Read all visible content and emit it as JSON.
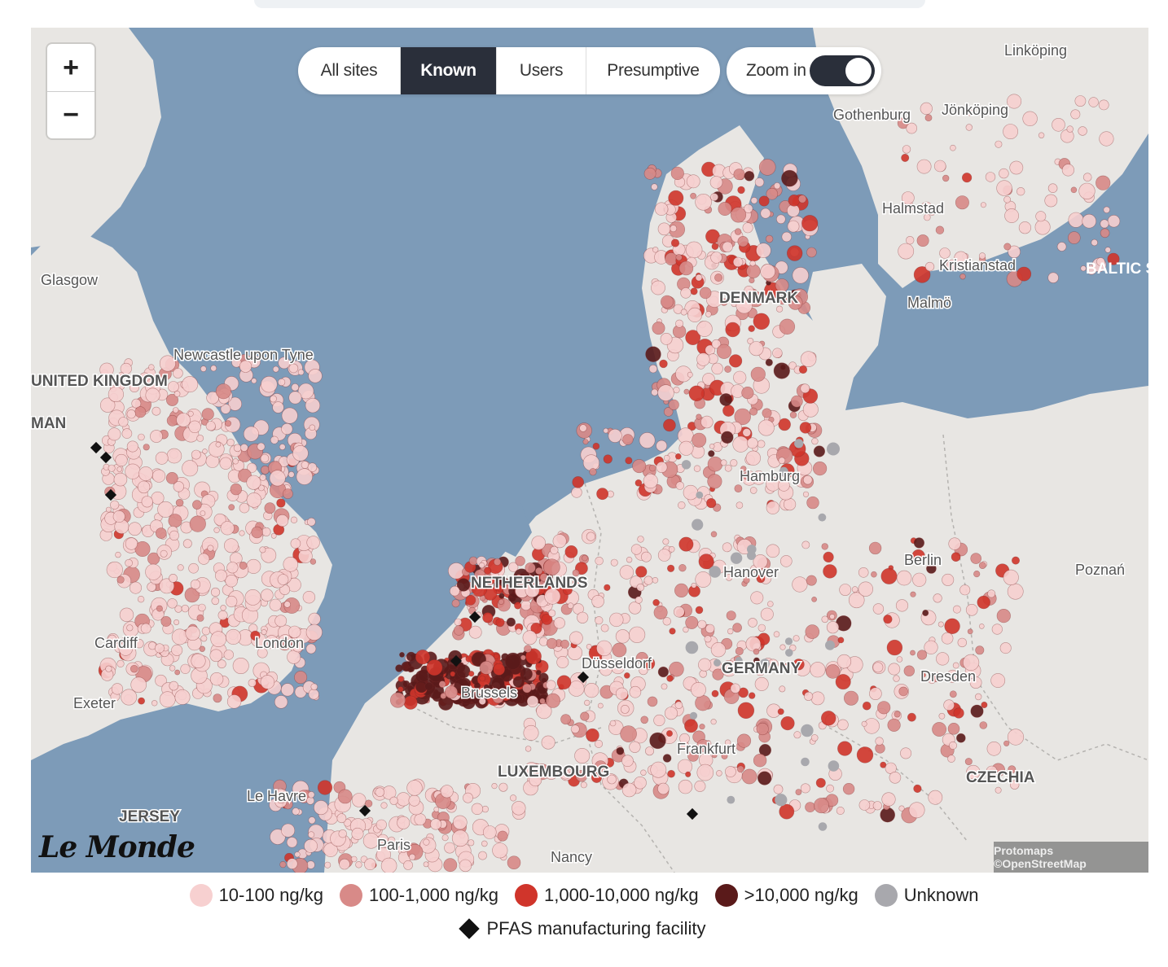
{
  "filters": {
    "options": [
      "All sites",
      "Known",
      "Users",
      "Presumptive"
    ],
    "selected": "Known",
    "zoom_label": "Zoom in",
    "zoom_enabled": true
  },
  "zoom_controls": {
    "in_label": "+",
    "out_label": "−"
  },
  "colors": {
    "sea": "#7d9bb8",
    "land": "#e8e6e3",
    "cat_10_100": "#f7d0d0",
    "cat_100_1000": "#d88a88",
    "cat_1000_10000": "#d0352b",
    "cat_gt_10000": "#5a1a1a",
    "unknown": "#a8a8ad"
  },
  "map_labels": [
    {
      "name": "Linköping",
      "kind": "city"
    },
    {
      "name": "Gothenburg",
      "kind": "city"
    },
    {
      "name": "Jönköping",
      "kind": "city"
    },
    {
      "name": "Halmstad",
      "kind": "city"
    },
    {
      "name": "Kristianstad",
      "kind": "city"
    },
    {
      "name": "BALTIC S",
      "kind": "sea"
    },
    {
      "name": "Malmö",
      "kind": "city"
    },
    {
      "name": "DENMARK",
      "kind": "country"
    },
    {
      "name": "Glasgow",
      "kind": "city"
    },
    {
      "name": "Newcastle upon Tyne",
      "kind": "city"
    },
    {
      "name": "UNITED KINGDOM",
      "kind": "country"
    },
    {
      "name": "MAN",
      "kind": "country"
    },
    {
      "name": "Hamburg",
      "kind": "city"
    },
    {
      "name": "Berlin",
      "kind": "city"
    },
    {
      "name": "Poznań",
      "kind": "city"
    },
    {
      "name": "Hanover",
      "kind": "city"
    },
    {
      "name": "NETHERLANDS",
      "kind": "country"
    },
    {
      "name": "London",
      "kind": "city"
    },
    {
      "name": "Cardiff",
      "kind": "city"
    },
    {
      "name": "Exeter",
      "kind": "city"
    },
    {
      "name": "Düsseldorf",
      "kind": "city"
    },
    {
      "name": "GERMANY",
      "kind": "country"
    },
    {
      "name": "Dresden",
      "kind": "city"
    },
    {
      "name": "Brussels",
      "kind": "city"
    },
    {
      "name": "Frankfurt",
      "kind": "city"
    },
    {
      "name": "LUXEMBOURG",
      "kind": "country"
    },
    {
      "name": "CZECHIA",
      "kind": "country"
    },
    {
      "name": "JERSEY",
      "kind": "country"
    },
    {
      "name": "Le Havre",
      "kind": "city"
    },
    {
      "name": "Paris",
      "kind": "city"
    },
    {
      "name": "Nancy",
      "kind": "city"
    }
  ],
  "logo": "Le Monde",
  "attribution": "Protomaps ©OpenStreetMap",
  "legend": {
    "items": [
      {
        "label": "10-100 ng/kg",
        "color": "#f7d0d0"
      },
      {
        "label": "100-1,000 ng/kg",
        "color": "#d88a88"
      },
      {
        "label": "1,000-10,000 ng/kg",
        "color": "#d0352b"
      },
      {
        "label": ">10,000 ng/kg",
        "color": "#5a1a1a"
      },
      {
        "label": "Unknown",
        "color": "#a8a8ad"
      }
    ],
    "facility_label": "PFAS manufacturing facility"
  }
}
